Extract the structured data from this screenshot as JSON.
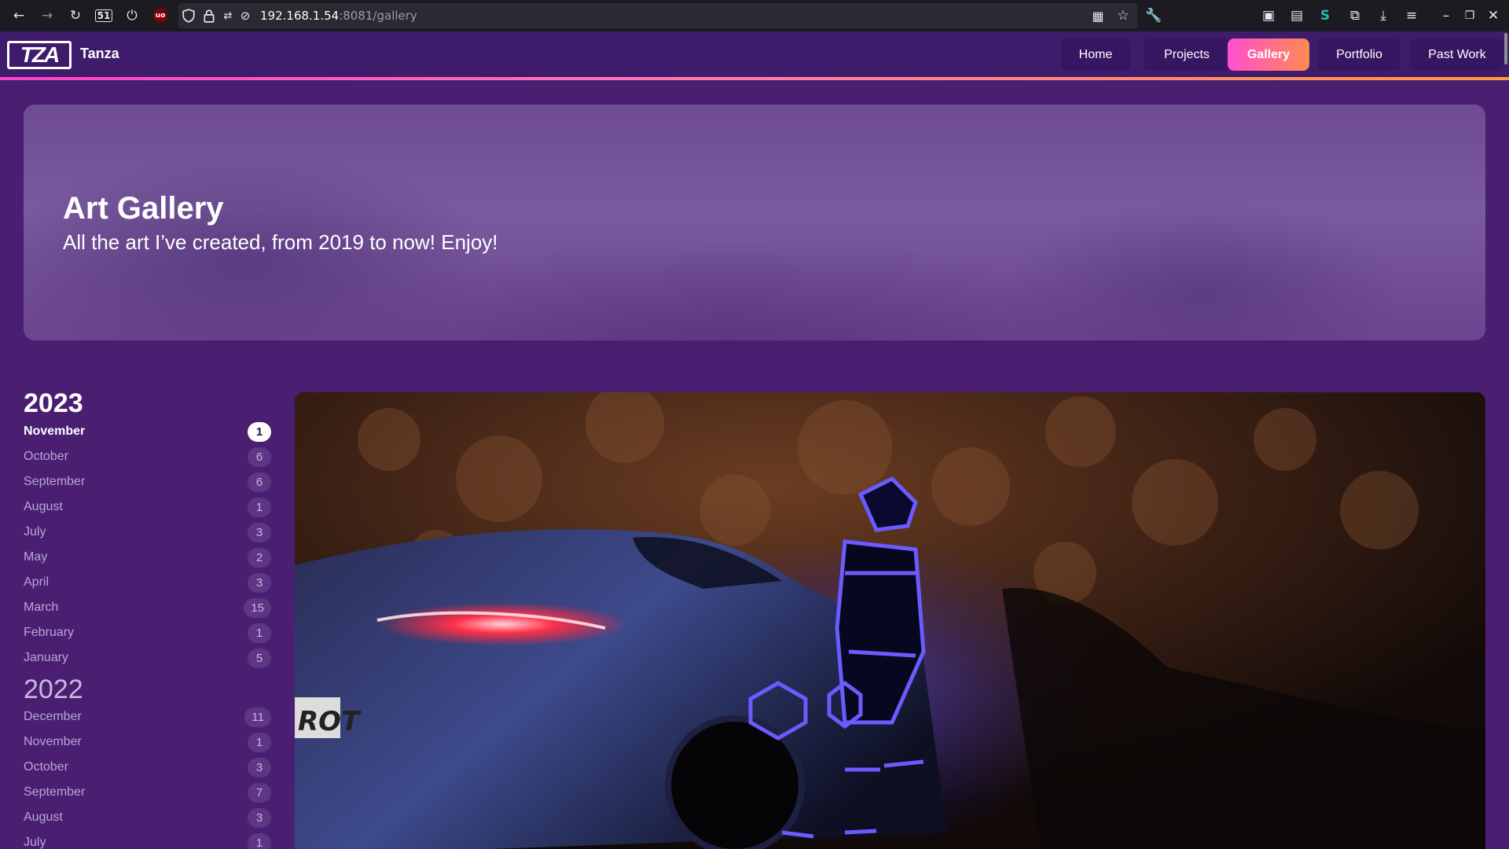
{
  "browser": {
    "url_host": "192.168.1.54",
    "url_rest": ":8081/gallery",
    "tab_count": "51"
  },
  "site": {
    "brand": "Tanza",
    "logo_text": "TZA",
    "nav": [
      {
        "label": "Home"
      },
      {
        "label": "Projects"
      },
      {
        "label": "Gallery"
      },
      {
        "label": "Portfolio"
      },
      {
        "label": "Past Work"
      }
    ],
    "active_nav": "Gallery"
  },
  "hero": {
    "title": "Art Gallery",
    "subtitle": "All the art I’ve created, from 2019 to now! Enjoy!"
  },
  "archive": {
    "year_2023": "2023",
    "months_2023": [
      {
        "label": "November",
        "count": "1"
      },
      {
        "label": "October",
        "count": "6"
      },
      {
        "label": "September",
        "count": "6"
      },
      {
        "label": "August",
        "count": "1"
      },
      {
        "label": "July",
        "count": "3"
      },
      {
        "label": "May",
        "count": "2"
      },
      {
        "label": "April",
        "count": "3"
      },
      {
        "label": "March",
        "count": "15"
      },
      {
        "label": "February",
        "count": "1"
      },
      {
        "label": "January",
        "count": "5"
      }
    ],
    "year_2022": "2022",
    "months_2022": [
      {
        "label": "December",
        "count": "11"
      },
      {
        "label": "November",
        "count": "1"
      },
      {
        "label": "October",
        "count": "3"
      },
      {
        "label": "September",
        "count": "7"
      },
      {
        "label": "August",
        "count": "3"
      },
      {
        "label": "July",
        "count": "1"
      }
    ]
  },
  "artwork": {
    "plate_text": "ROT"
  },
  "colors": {
    "background": "#4a1f72",
    "nav_bg": "#3f1b6b",
    "accent_gradient_start": "#ff4fd0",
    "accent_gradient_end": "#ff8a50"
  }
}
